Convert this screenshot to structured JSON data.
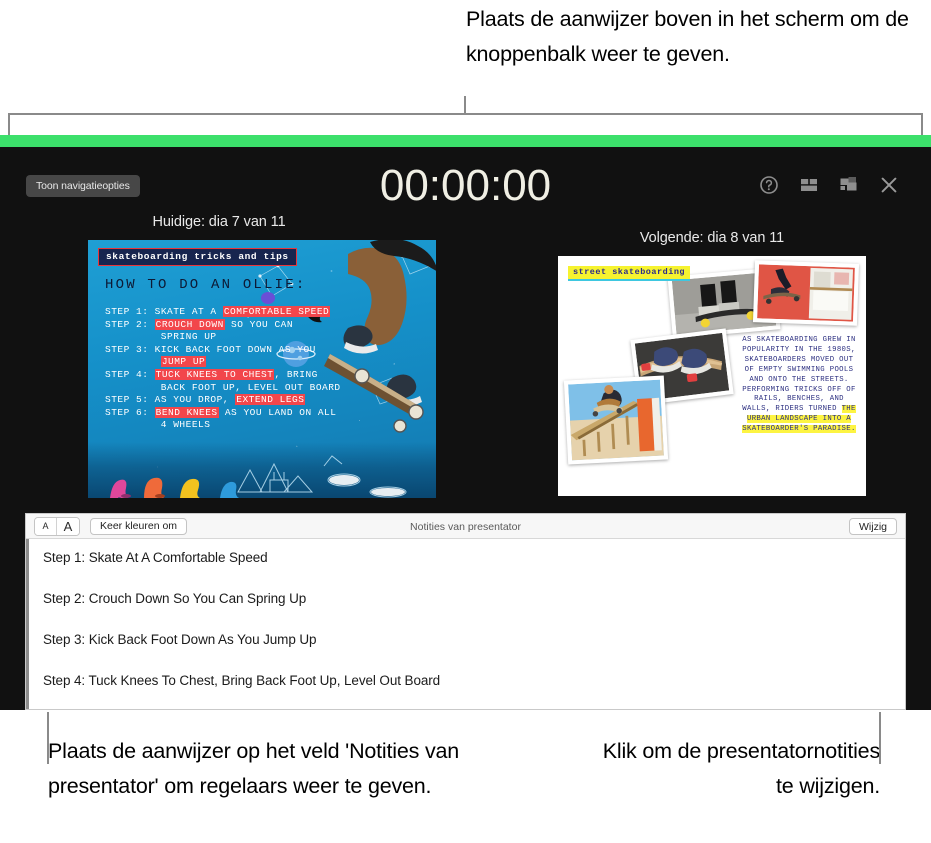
{
  "callouts": {
    "top": "Plaats de aanwijzer boven in het scherm om de knoppenbalk weer te geven.",
    "bottom_left": "Plaats de aanwijzer op het veld 'Notities van presentator' om regelaars weer te geven.",
    "bottom_right": "Klik om de presentatornotities te wijzigen."
  },
  "colors": {
    "accent_green": "#3ce06b",
    "window_background": "#111111",
    "timer_text": "#f0efe4",
    "highlight_red": "#f2464b",
    "highlight_yellow": "#fdf442"
  },
  "toolbar": {
    "nav_options_label": "Toon navigatieopties",
    "timer": "00:00:00",
    "icons": [
      {
        "name": "help-icon",
        "label": "Help"
      },
      {
        "name": "layout-icon",
        "label": "Lay-out"
      },
      {
        "name": "swap-displays-icon",
        "label": "Wissel schermen"
      },
      {
        "name": "close-icon",
        "label": "Sluit"
      }
    ]
  },
  "slides": {
    "current_label": "Huidige: dia 7 van 11",
    "next_label": "Volgende: dia 8 van 11",
    "current": {
      "title_badge": "skateboarding tricks and tips",
      "heading": "HOW TO DO AN OLLIE:",
      "steps": [
        {
          "label": "STEP 1:",
          "parts": [
            {
              "t": " SKATE AT A ",
              "hl": false
            },
            {
              "t": "COMFORTABLE SPEED",
              "hl": true
            }
          ]
        },
        {
          "label": "STEP 2:",
          "parts": [
            {
              "t": " ",
              "hl": false
            },
            {
              "t": "CROUCH DOWN",
              "hl": true
            },
            {
              "t": " SO YOU CAN",
              "hl": false
            }
          ]
        },
        {
          "label": "",
          "parts": [
            {
              "t": "         SPRING UP",
              "hl": false
            }
          ]
        },
        {
          "label": "STEP 3:",
          "parts": [
            {
              "t": " KICK BACK FOOT DOWN AS YOU",
              "hl": false
            }
          ]
        },
        {
          "label": "",
          "parts": [
            {
              "t": "         ",
              "hl": false
            },
            {
              "t": "JUMP UP",
              "hl": true
            }
          ]
        },
        {
          "label": "STEP 4:",
          "parts": [
            {
              "t": " ",
              "hl": false
            },
            {
              "t": "TUCK KNEES TO CHEST",
              "hl": true
            },
            {
              "t": ", BRING",
              "hl": false
            }
          ]
        },
        {
          "label": "",
          "parts": [
            {
              "t": "         BACK FOOT UP, LEVEL OUT BOARD",
              "hl": false
            }
          ]
        },
        {
          "label": "STEP 5:",
          "parts": [
            {
              "t": " AS YOU DROP, ",
              "hl": false
            },
            {
              "t": "EXTEND LEGS",
              "hl": true
            }
          ]
        },
        {
          "label": "STEP 6:",
          "parts": [
            {
              "t": " ",
              "hl": false
            },
            {
              "t": "BEND KNEES",
              "hl": true
            },
            {
              "t": " AS YOU LAND ON ALL",
              "hl": false
            }
          ]
        },
        {
          "label": "",
          "parts": [
            {
              "t": "         4 WHEELS",
              "hl": false
            }
          ]
        }
      ]
    },
    "next": {
      "title_badge": "street skateboarding",
      "body_parts": [
        {
          "t": "AS SKATEBOARDING GREW IN POPULARITY IN THE 1980S, SKATEBOARDERS MOVED OUT OF EMPTY SWIMMING POOLS AND ONTO THE STREETS. PERFORMING TRICKS OFF OF RAILS, BENCHES, AND WALLS, RIDERS TURNED ",
          "hl": false
        },
        {
          "t": "THE URBAN LANDSCAPE INTO A SKATEBOARDER'S PARADISE.",
          "hl": true
        }
      ]
    }
  },
  "notes": {
    "title": "Notities van presentator",
    "font_smaller_label": "A",
    "font_larger_label": "A",
    "invert_colors_label": "Keer kleuren om",
    "edit_label": "Wijzig",
    "lines": [
      "Step 1: Skate At A Comfortable Speed",
      "Step 2: Crouch Down So You Can Spring Up",
      "Step 3: Kick Back Foot Down As You Jump Up",
      "Step 4: Tuck Knees To Chest, Bring Back Foot Up, Level Out Board"
    ]
  }
}
